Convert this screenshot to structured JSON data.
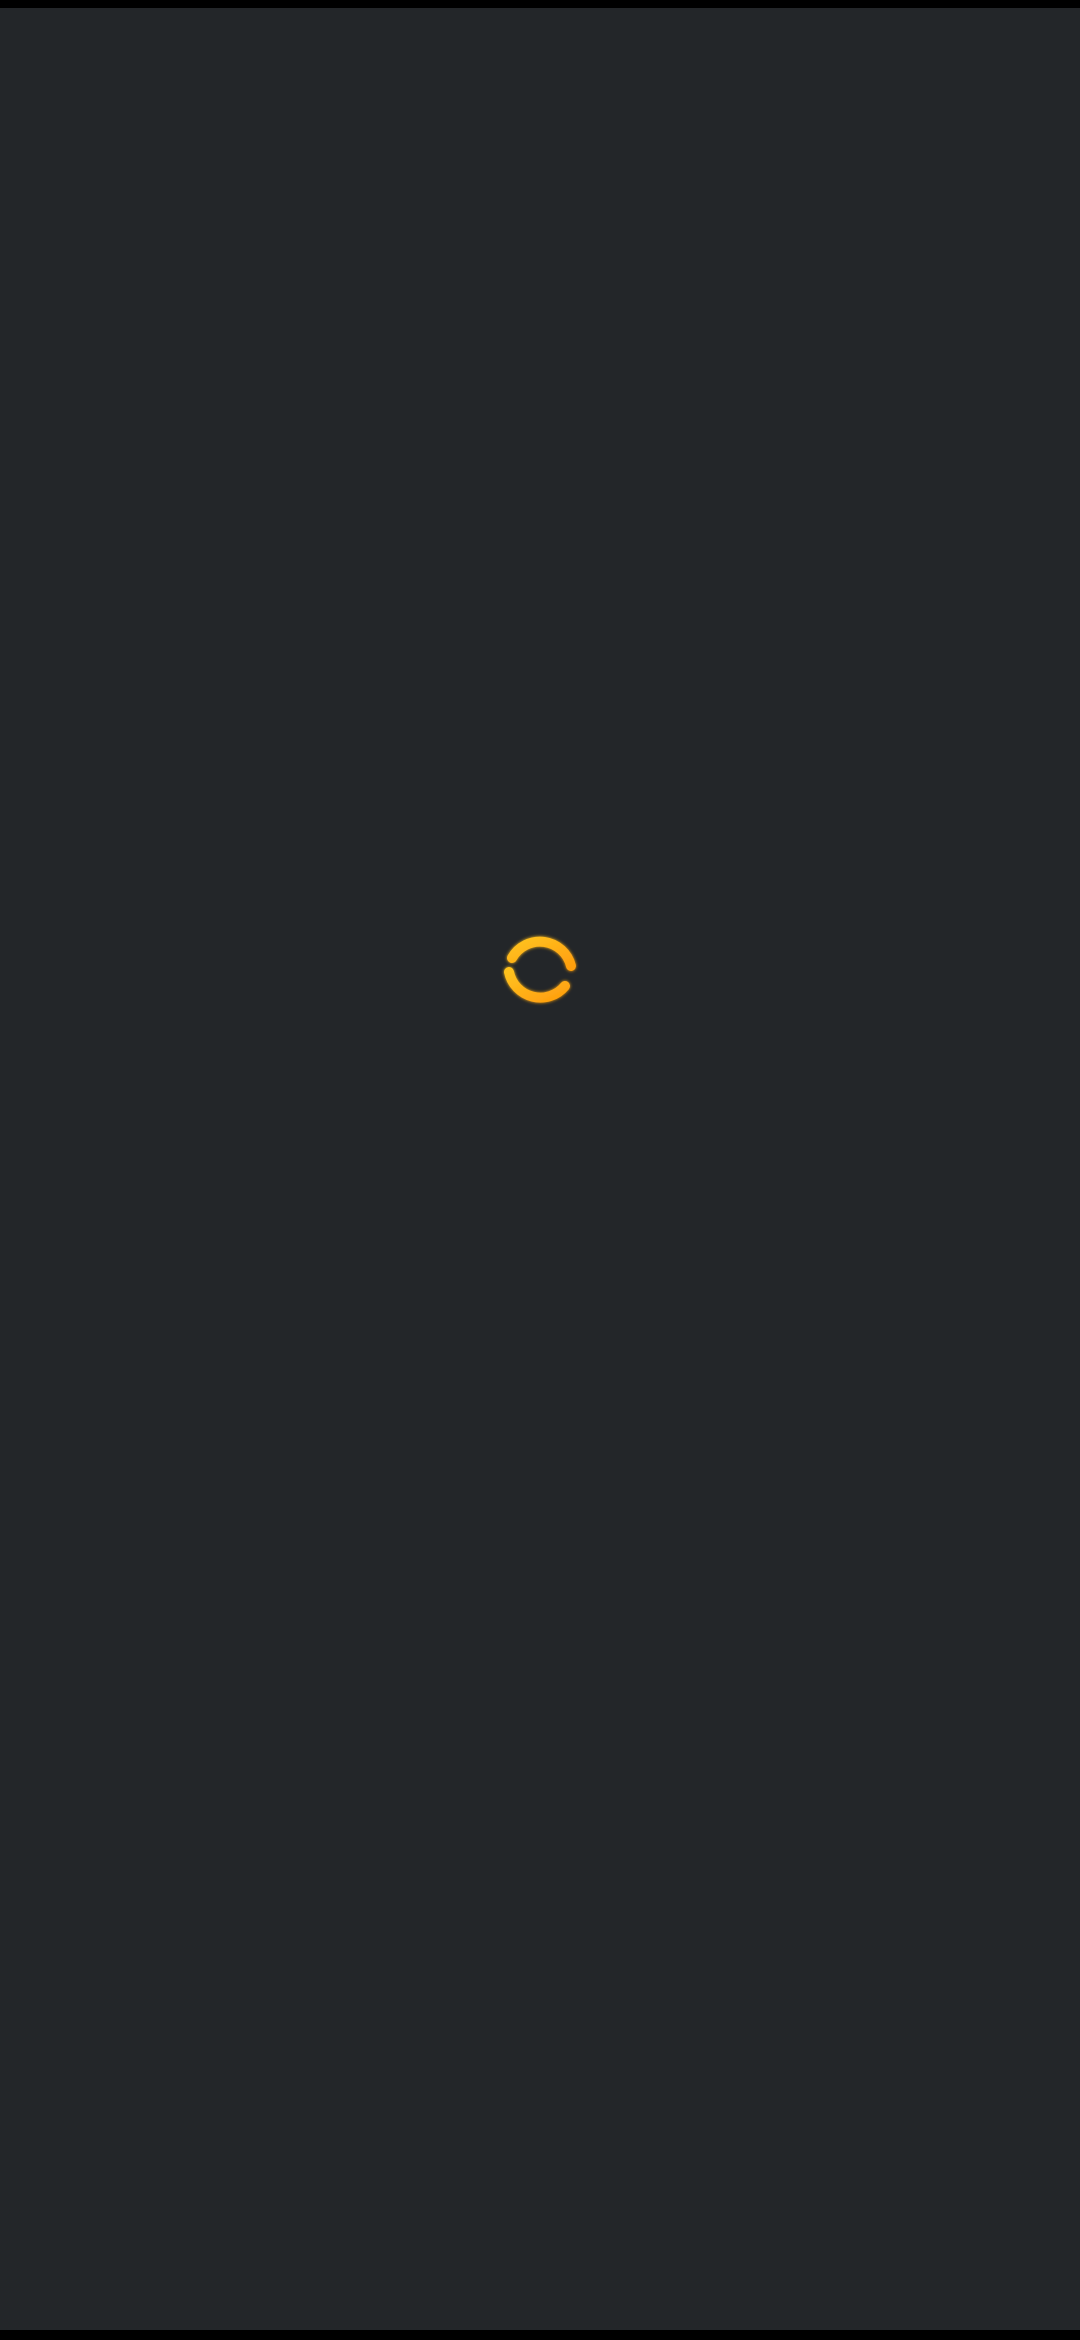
{
  "screen": {
    "state": "loading"
  },
  "colors": {
    "background": "#232629",
    "frame": "#000000",
    "spinner_light": "#FFC21F",
    "spinner_dark": "#FF9F0F"
  },
  "icons": {
    "loading": "loading-spinner-icon"
  }
}
